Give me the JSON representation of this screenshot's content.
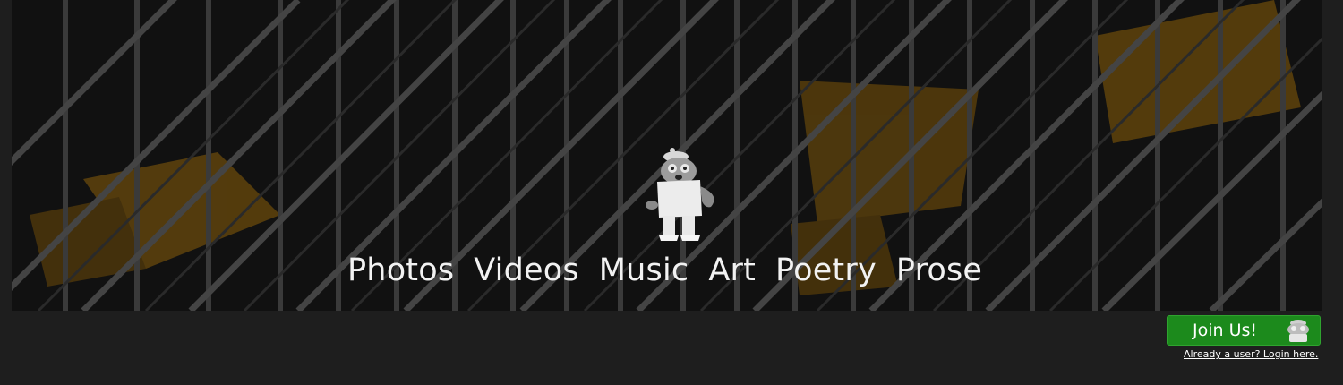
{
  "hero": {
    "nav_items": [
      "Photos",
      "Videos",
      "Music",
      "Art",
      "Poetry",
      "Prose"
    ]
  },
  "cta": {
    "join_label": "Join Us!",
    "login_text": "Already a user? Login here."
  },
  "colors": {
    "page_background": "#1e1e1e",
    "join_button": "#1c8a1c",
    "hero_accent": "#c9900a"
  }
}
